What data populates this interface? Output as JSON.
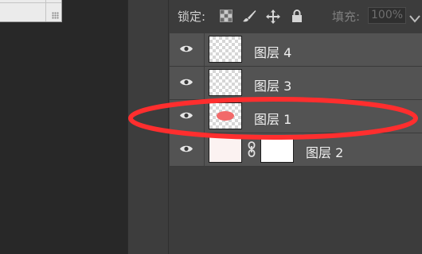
{
  "lock_bar": {
    "label": "锁定:",
    "icons": [
      "lock-transparent-pixels-icon",
      "lock-image-pixels-icon",
      "lock-position-icon",
      "lock-all-icon"
    ],
    "fill_label": "填充:",
    "fill_value": "100%"
  },
  "layers": [
    {
      "name": "图层 4",
      "visible": true,
      "thumbnail": "transparent"
    },
    {
      "name": "图层 3",
      "visible": true,
      "thumbnail": "transparent"
    },
    {
      "name": "图层 1",
      "visible": true,
      "thumbnail": "red-ellipse",
      "highlighted": true
    },
    {
      "name": "图层 2",
      "visible": true,
      "thumbnail": "light-fill",
      "linked_mask": true
    }
  ],
  "colors": {
    "panel_bg": "#3c3c3c",
    "row_bg": "#535353",
    "highlight_ring": "#ff2e2e",
    "ellipse_fill": "#f26a6a"
  }
}
